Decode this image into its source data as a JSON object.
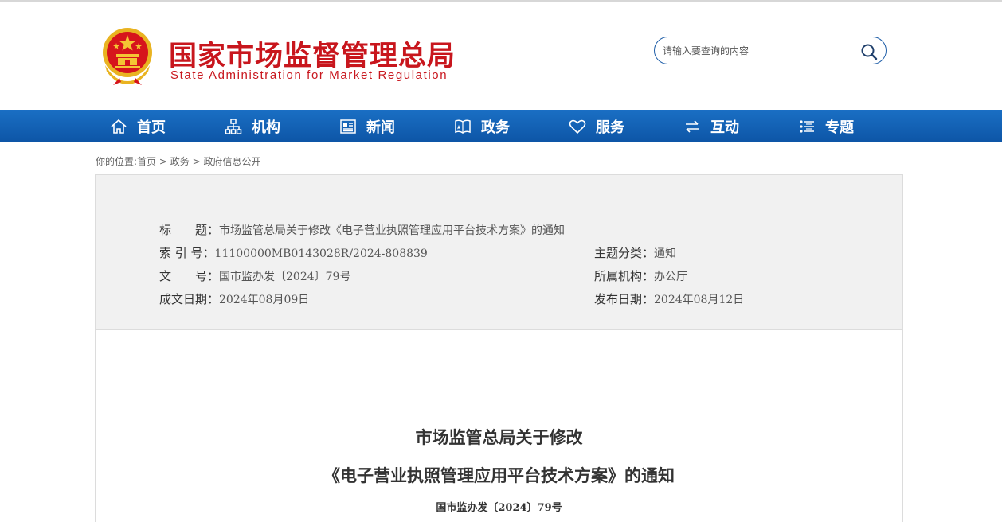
{
  "header": {
    "logo_cn": "国家市场监督管理总局",
    "logo_en": "State Administration for Market Regulation",
    "search_placeholder": "请输入要查询的内容"
  },
  "nav": {
    "items": [
      {
        "label": "首页",
        "icon": "home-icon"
      },
      {
        "label": "机构",
        "icon": "org-chart-icon"
      },
      {
        "label": "新闻",
        "icon": "newspaper-icon"
      },
      {
        "label": "政务",
        "icon": "book-icon"
      },
      {
        "label": "服务",
        "icon": "heart-icon"
      },
      {
        "label": "互动",
        "icon": "exchange-arrows-icon"
      },
      {
        "label": "专题",
        "icon": "topic-list-icon"
      }
    ]
  },
  "breadcrumb": {
    "prefix": "你的位置:",
    "items": [
      "首页",
      "政务",
      "政府信息公开"
    ],
    "separator": " > "
  },
  "meta": {
    "title_label": "标　　题：",
    "title_value": "市场监管总局关于修改《电子营业执照管理应用平台技术方案》的通知",
    "index_label": "索 引 号：",
    "index_value": "11100000MB0143028R/2024-808839",
    "topic_label": "主题分类：",
    "topic_value": "通知",
    "docno_label": "文　　号：",
    "docno_value": "国市监办发〔2024〕79号",
    "org_label": "所属机构：",
    "org_value": "办公厅",
    "created_label": "成文日期：",
    "created_value": "2024年08月09日",
    "published_label": "发布日期：",
    "published_value": "2024年08月12日"
  },
  "document": {
    "title_line1": "市场监管总局关于修改",
    "title_line2": "《电子营业执照管理应用平台技术方案》的通知",
    "doc_number": "国市监办发〔2024〕79号"
  },
  "colors": {
    "brand_red": "#c8161d",
    "nav_blue": "#0d55a6",
    "search_border": "#1f5ea8",
    "meta_bg": "#f1f1f1"
  }
}
